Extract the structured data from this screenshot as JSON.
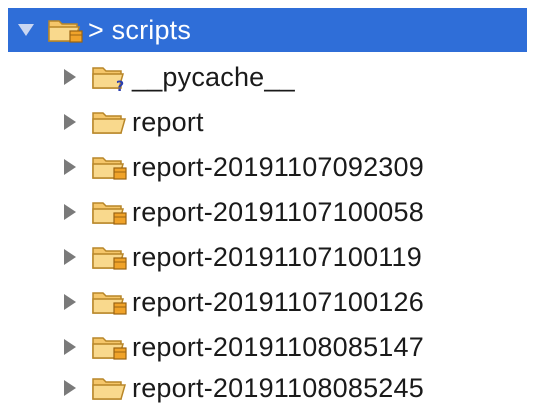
{
  "tree": {
    "root": {
      "label": "> scripts",
      "expanded": true,
      "icon": "package-folder-icon",
      "selected": true
    },
    "children": [
      {
        "label": "__pycache__",
        "icon": "unversioned-folder-icon",
        "expanded": false
      },
      {
        "label": "report",
        "icon": "folder-icon",
        "expanded": false
      },
      {
        "label": "report-20191107092309",
        "icon": "package-folder-icon",
        "expanded": false
      },
      {
        "label": "report-20191107100058",
        "icon": "package-folder-icon",
        "expanded": false
      },
      {
        "label": "report-20191107100119",
        "icon": "package-folder-icon",
        "expanded": false
      },
      {
        "label": "report-20191107100126",
        "icon": "package-folder-icon",
        "expanded": false
      },
      {
        "label": "report-20191108085147",
        "icon": "package-folder-icon",
        "expanded": false
      },
      {
        "label": "report-20191108085245",
        "icon": "folder-icon",
        "expanded": false
      }
    ]
  },
  "colors": {
    "selection": "#2f6ed8",
    "folder_fill": "#f5c66a",
    "folder_stroke": "#b88628",
    "badge_gold": "#f0a32a",
    "twisty": "#7a7a7a"
  }
}
